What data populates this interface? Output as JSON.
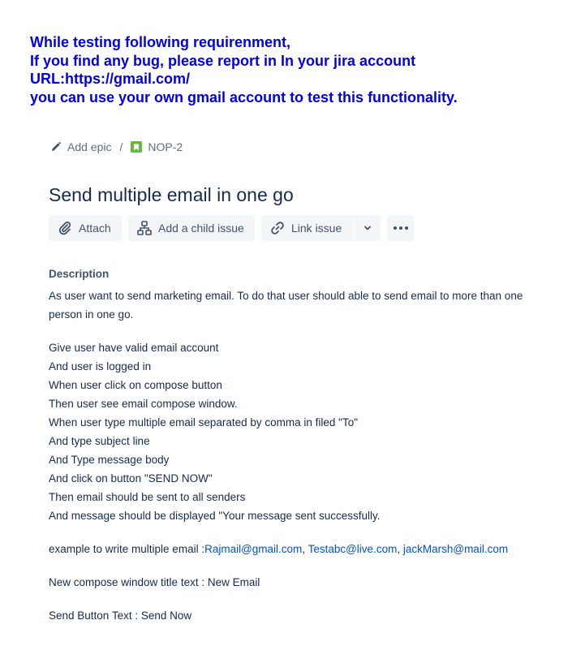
{
  "instructions": [
    "While testing following requirenment,",
    "If you find any bug, please report in In your jira account",
    "URL:https://gmail.com/",
    "you can use your own gmail account to test this functionality."
  ],
  "breadcrumb": {
    "epic_label": "Add epic",
    "separator": "/",
    "issue_key": "NOP-2"
  },
  "issue": {
    "title": "Send multiple email in one go"
  },
  "toolbar": {
    "attach_label": "Attach",
    "child_issue_label": "Add a child issue",
    "link_issue_label": "Link issue"
  },
  "description": {
    "heading": "Description",
    "intro_line1": "As user want to send  marketing email. To do that user should able to send email to more than one",
    "intro_line2": "person in one go.",
    "steps": [
      "Give user have valid email account",
      "And user is logged in",
      "When user click on compose button",
      "Then user see email compose window.",
      "When user type multiple email separated by comma in filed \"To\"",
      "And type subject line",
      "And Type message body",
      "And click on button \"SEND NOW\"",
      "Then email should be sent to all  senders",
      "And message should be displayed \"Your message sent successfully."
    ],
    "example_prefix": "example to write multiple email :",
    "example_emails": [
      "Rajmail@gmail.com",
      "Testabc@live.com",
      "jackMarsh@mail.com"
    ],
    "example_separator": ", ",
    "window_title_line": "New compose window title text : New Email",
    "send_button_line": "Send Button Text : Send Now"
  },
  "colors": {
    "instructions": "#0000ee",
    "link": "#0052cc",
    "story_icon": "#63ba3c",
    "button_bg": "#f4f5f7"
  },
  "icons": {
    "epic": "pencil-icon",
    "issue_type": "story-icon",
    "attach": "paperclip-icon",
    "child": "hierarchy-icon",
    "link": "link-icon",
    "dropdown": "chevron-down-icon",
    "more": "more-icon"
  }
}
